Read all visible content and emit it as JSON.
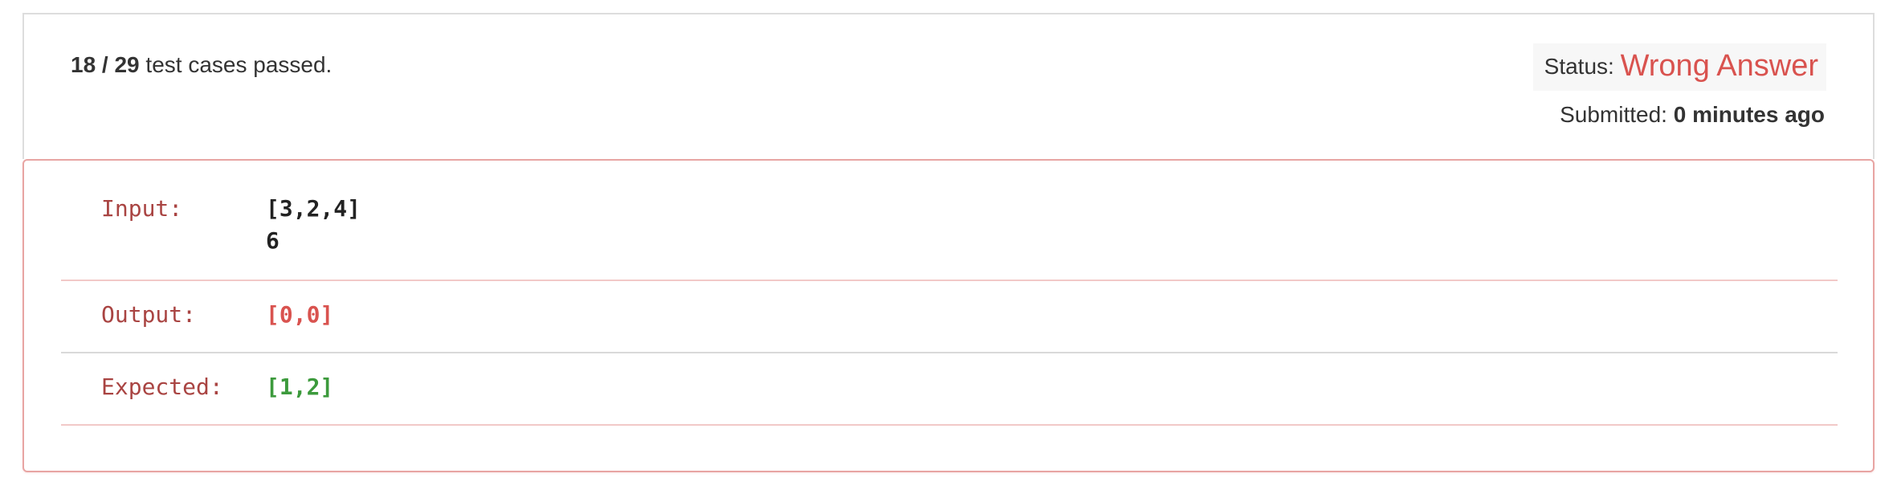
{
  "summary": {
    "passed": "18 / 29",
    "passed_suffix": " test cases passed."
  },
  "status": {
    "label": "Status: ",
    "value": "Wrong Answer",
    "color": "#d9534f"
  },
  "submitted": {
    "label": "Submitted: ",
    "value": "0 minutes ago"
  },
  "details": {
    "input": {
      "label": "Input:",
      "lines": [
        "[3,2,4]",
        "6"
      ]
    },
    "output": {
      "label": "Output:",
      "value": "[0,0]",
      "color": "#d9534f"
    },
    "expected": {
      "label": "Expected:",
      "value": "[1,2]",
      "color": "#3c9a3c"
    }
  }
}
